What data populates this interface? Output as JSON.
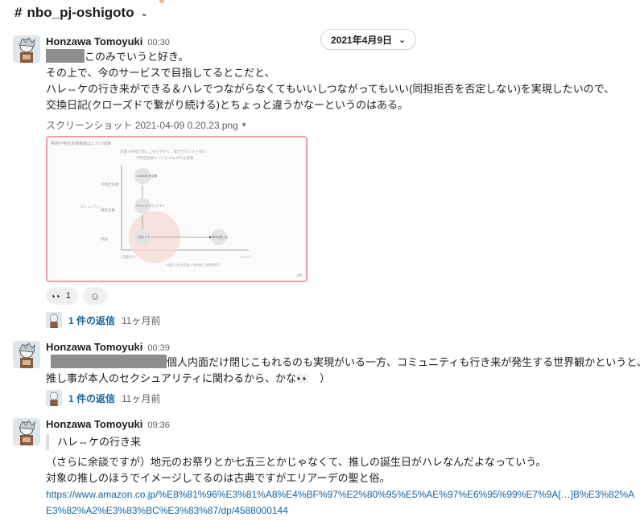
{
  "header": {
    "channel_name": "nbo_pj-oshigoto",
    "hash": "#"
  },
  "date_divider": {
    "label": "2021年4月9日"
  },
  "messages": [
    {
      "author": "Honzawa Tomoyuki",
      "time": "00:30",
      "line1_suffix": "このみでいうと好き。",
      "line2": "その上で、今のサービスで目指してるとこだと、",
      "line3": "ハレ⇔ケの行き来ができる＆ハレでつながらなくてもいいしつながってもいい(同担拒否を否定しない)を実現したいので、",
      "line4": "交換日記(クローズドで繋がり続ける)とちょっと違うかなーというのはある。",
      "file": {
        "name": "スクリーンショット 2021-04-09 0.20.23.png",
        "title": "常時不特定多数接続はしない体験",
        "subtitle1": "内面×単独で閉じこもりやすく、繋がりたい人・時に",
        "subtitle2": "不特定多数×ハレとつながれる状態",
        "ylabel": "コミュニティ",
        "y_high": "不特定多数",
        "y_mid": "特定多数",
        "y_low": "単独",
        "x_left": "内面(ケ)",
        "x_right": "(ハレ)",
        "bubble_top": "Cabinet 的空間",
        "bubble_mid": "チャット/コミュニティ",
        "bubble_low": "日記/メモ",
        "bubble_right": "SNS/推し活",
        "note": "→内面と外の回復 ×常時他人接続(NO)",
        "page": "100"
      },
      "reactions": [
        {
          "emoji": "👀",
          "count": "1"
        }
      ],
      "add_reaction_icon": "☺",
      "thread": {
        "replies": "1 件の返信",
        "when": "11ヶ月前"
      }
    },
    {
      "author": "Honzawa Tomoyuki",
      "time": "00:39",
      "line1_suffix": "個人内面だけ閉じこもれるのも実現がいる一方、コミュニティも行き来が発生する世界観かというと、",
      "line2": "推し事が本人のセクシュアリティに関わるから、かな👀　）",
      "thread": {
        "replies": "1 件の返信",
        "when": "11ヶ月前"
      }
    },
    {
      "author": "Honzawa Tomoyuki",
      "time": "09:36",
      "quote": "ハレ⇔ケの行き来",
      "line2": "（さらに余談ですが）地元のお祭りとか七五三とかじゃなくて、推しの誕生日がハレなんだよなっていう。",
      "line3": "対象の推しのほうでイメージしてるのは古典ですがエリアーデの聖と俗。",
      "link1": "https://www.amazon.co.jp/%E8%81%96%E3%81%A8%E4%BF%97%E2%80%95%E5%AE%97%E6%95%99%E7%9A[…]B%E3%82%A",
      "link2": "E3%82%A2%E3%83%BC%E3%83%87/dp/4588000144"
    }
  ],
  "colors": {
    "link": "#1264a3",
    "redaction": "#8e8e8e",
    "thumb_border": "#e7a2a8"
  },
  "icons": {
    "channel_chevron": "chevron-down-icon",
    "date_chevron": "chevron-down-icon",
    "file_caret": "caret-down-icon"
  }
}
